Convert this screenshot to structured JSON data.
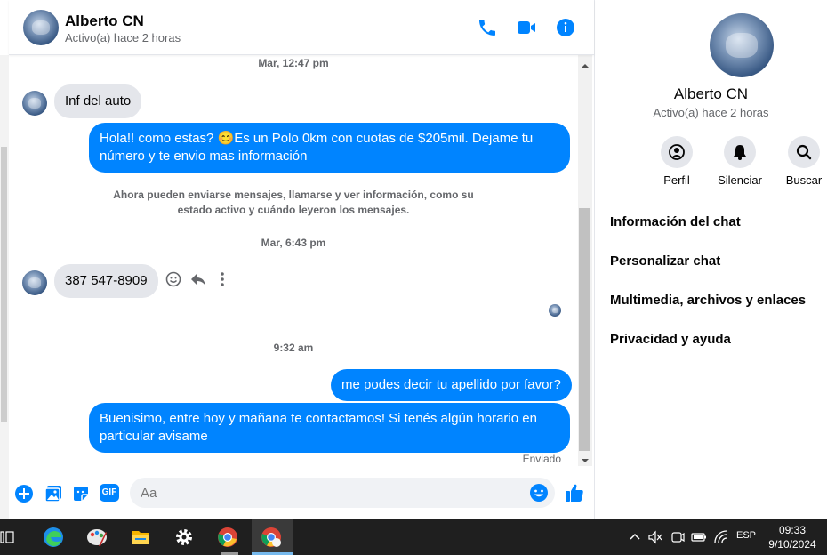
{
  "header": {
    "name": "Alberto CN",
    "status": "Activo(a) hace 2 horas"
  },
  "messages": {
    "ts1": "Mar, 12:47 pm",
    "in1": "Inf del auto",
    "out1": "Hola!! como estas? 😊Es un Polo 0km con cuotas de $205mil. Dejame tu número y te envio mas información",
    "system": "Ahora pueden enviarse mensajes, llamarse y ver información, como su estado activo y cuándo leyeron los mensajes.",
    "ts2": "Mar, 6:43 pm",
    "in2": "387 547-8909",
    "ts3": "9:32 am",
    "out2": "me podes decir tu apellido por favor?",
    "out3": "Buenisimo, entre hoy y mañana te contactamos! Si tenés algún horario en particular avisame",
    "delivery": "Enviado"
  },
  "composer": {
    "placeholder": "Aa",
    "gif_label": "GIF"
  },
  "right_pane": {
    "name": "Alberto CN",
    "status": "Activo(a) hace 2 horas",
    "actions": [
      {
        "label": "Perfil"
      },
      {
        "label": "Silenciar"
      },
      {
        "label": "Buscar"
      }
    ],
    "menu": [
      "Información del chat",
      "Personalizar chat",
      "Multimedia, archivos y enlaces",
      "Privacidad y ayuda"
    ]
  },
  "taskbar": {
    "lang": "ESP",
    "time": "09:33",
    "date": "9/10/2024"
  },
  "colors": {
    "accent": "#0084ff",
    "bubble_in": "#e4e6eb",
    "taskbar": "#1f1f1f"
  }
}
